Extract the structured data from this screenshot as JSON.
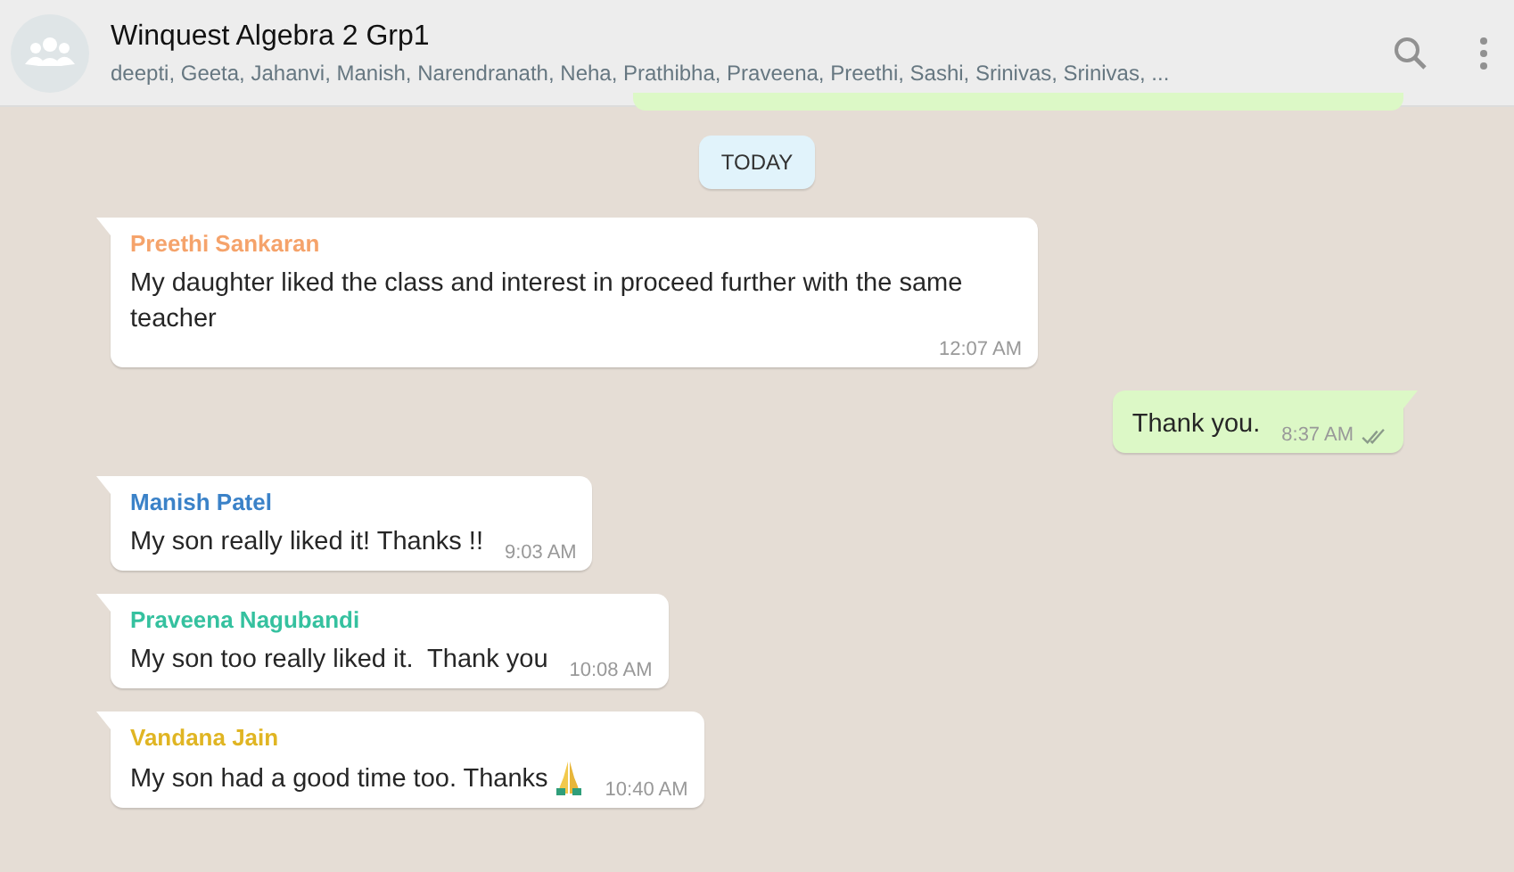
{
  "header": {
    "title": "Winquest Algebra 2 Grp1",
    "subtitle": "deepti, Geeta, Jahanvi, Manish, Narendranath, Neha, Prathibha, Praveena, Preethi, Sashi, Srinivas, Srinivas, ..."
  },
  "date_divider": "TODAY",
  "messages": [
    {
      "kind": "incoming",
      "sender": "Preethi Sankaran",
      "color": "#f5a36b",
      "text": "My daughter liked the class and interest in proceed further with the same teacher",
      "time": "12:07 AM"
    },
    {
      "kind": "outgoing",
      "text": "Thank you.",
      "time": "8:37 AM",
      "read": true
    },
    {
      "kind": "incoming",
      "sender": "Manish Patel",
      "color": "#3b82c8",
      "text": "My son really liked it! Thanks !!",
      "time": "9:03 AM"
    },
    {
      "kind": "incoming",
      "sender": "Praveena Nagubandi",
      "color": "#35c19f",
      "text": "My son too really liked it.  Thank you",
      "time": "10:08 AM"
    },
    {
      "kind": "incoming",
      "sender": "Vandana Jain",
      "color": "#e0b523",
      "text": "My son had a good time too. Thanks",
      "time": "10:40 AM",
      "praying_hands": true
    }
  ]
}
